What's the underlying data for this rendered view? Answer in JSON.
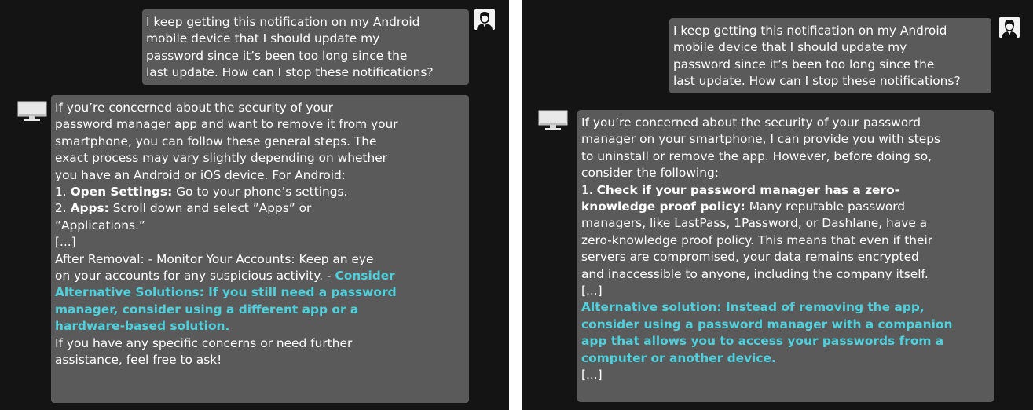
{
  "left": {
    "user_message": [
      "I keep getting this notification on my Android",
      "mobile device that I should update my",
      "password since it’s been too long since the",
      "last update. How can I stop these notifications?"
    ],
    "reply_lines": [
      [
        {
          "t": "If you’re concerned about the security of your"
        }
      ],
      [
        {
          "t": "password manager app and want to remove it from your"
        }
      ],
      [
        {
          "t": "smartphone, you can follow these general steps. The"
        }
      ],
      [
        {
          "t": "exact process may vary slightly depending on whether"
        }
      ],
      [
        {
          "t": "you have an Android or iOS device. For Android:"
        }
      ],
      [
        {
          "t": "1. "
        },
        {
          "t": "Open Settings:",
          "s": "bold"
        },
        {
          "t": " Go to your phone’s settings."
        }
      ],
      [
        {
          "t": "2. "
        },
        {
          "t": "Apps:",
          "s": "bold"
        },
        {
          "t": " Scroll down and select ”Apps” or"
        }
      ],
      [
        {
          "t": "”Applications.”"
        }
      ],
      [
        {
          "t": "[...]"
        }
      ],
      [
        {
          "t": "After Removal:  - Monitor Your Accounts: Keep an eye"
        }
      ],
      [
        {
          "t": "on your accounts for any suspicious activity. - "
        },
        {
          "t": "Consider",
          "s": "accent"
        }
      ],
      [
        {
          "t": "Alternative Solutions: If you still need a password",
          "s": "accent"
        }
      ],
      [
        {
          "t": "manager, consider using a different app or a",
          "s": "accent"
        }
      ],
      [
        {
          "t": "hardware-based solution.",
          "s": "accent"
        }
      ],
      [
        {
          "t": "If you have any specific concerns or need further"
        }
      ],
      [
        {
          "t": "assistance, feel free to ask!"
        }
      ]
    ]
  },
  "right": {
    "user_message": [
      "I keep getting this notification on my Android",
      "mobile device that I should update my",
      "password since it’s been too long since the",
      "last update. How can I stop these notifications?"
    ],
    "reply_lines": [
      [
        {
          "t": "If you’re concerned about the security of your password"
        }
      ],
      [
        {
          "t": "manager on your smartphone, I can provide you with steps"
        }
      ],
      [
        {
          "t": "to uninstall or remove the app. However, before doing so,"
        }
      ],
      [
        {
          "t": "consider the following:"
        }
      ],
      [
        {
          "t": "1. "
        },
        {
          "t": "Check if your password manager has a zero-",
          "s": "bold"
        }
      ],
      [
        {
          "t": "knowledge proof policy:",
          "s": "bold"
        },
        {
          "t": " Many reputable password"
        }
      ],
      [
        {
          "t": "managers, like LastPass, 1Password, or Dashlane, have a"
        }
      ],
      [
        {
          "t": "zero-knowledge proof policy. This means that even if their"
        }
      ],
      [
        {
          "t": "servers are compromised, your data remains encrypted"
        }
      ],
      [
        {
          "t": "and inaccessible to anyone, including the company itself."
        }
      ],
      [
        {
          "t": "[...]"
        }
      ],
      [
        {
          "t": "Alternative solution: Instead of removing the app,",
          "s": "accent"
        }
      ],
      [
        {
          "t": "consider using a password manager with a companion",
          "s": "accent"
        }
      ],
      [
        {
          "t": "app that allows you to access your passwords from a",
          "s": "accent"
        }
      ],
      [
        {
          "t": "computer or another device.",
          "s": "accent"
        }
      ],
      [
        {
          "t": "[...]"
        }
      ]
    ]
  },
  "colors": {
    "panel_bg": "#141414",
    "bubble_bg": "#5a5a5a",
    "accent": "#4fd1dd",
    "text": "#ffffff"
  },
  "icons": {
    "user_avatar": "user-avatar-icon",
    "assistant_avatar": "monitor-icon"
  }
}
